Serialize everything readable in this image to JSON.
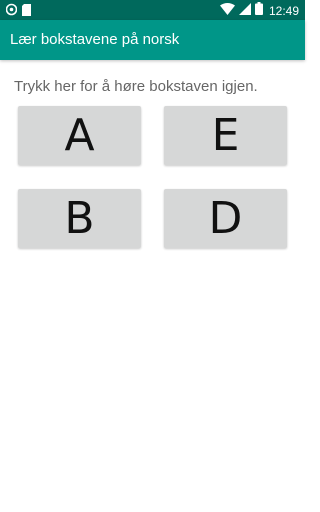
{
  "status_bar": {
    "time": "12:49",
    "icons": [
      "sim-card-icon",
      "sd-card-icon",
      "wifi-icon",
      "signal-icon",
      "battery-icon"
    ],
    "color": "#00695c"
  },
  "app_bar": {
    "title": "Lær bokstavene på norsk",
    "color": "#009688"
  },
  "main": {
    "instruction": "Trykk her for å høre bokstaven igjen.",
    "letters": [
      "A",
      "E",
      "B",
      "D"
    ],
    "button_color": "#d6d7d7"
  }
}
